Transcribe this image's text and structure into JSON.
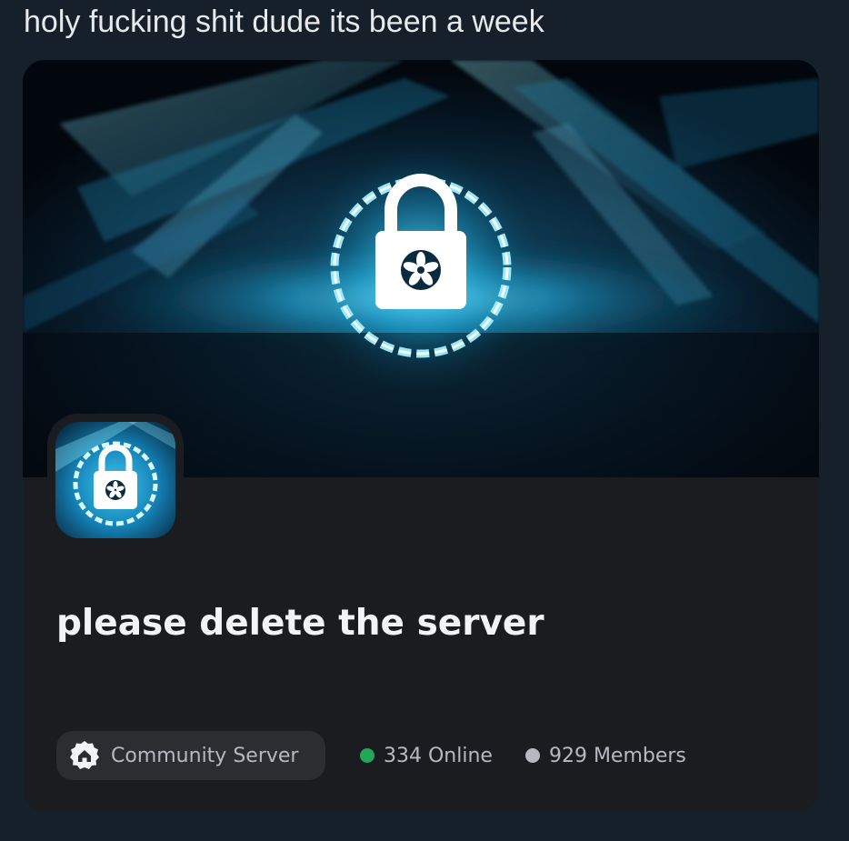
{
  "post": {
    "text": "holy fucking shit dude its been a week"
  },
  "invite_card": {
    "server_name": "please delete the server",
    "community_label": "Community Server",
    "online_text": "334 Online",
    "members_text": "929 Members",
    "banner_icon": "lock-icon",
    "community_icon": "home-badge-icon"
  },
  "colors": {
    "page_background": "#15202b",
    "card_background": "#1b1c20",
    "pill_background": "#2b2d31",
    "online_dot": "#23a55a",
    "members_dot": "#b5bac1",
    "glow": "#38d4ff"
  }
}
